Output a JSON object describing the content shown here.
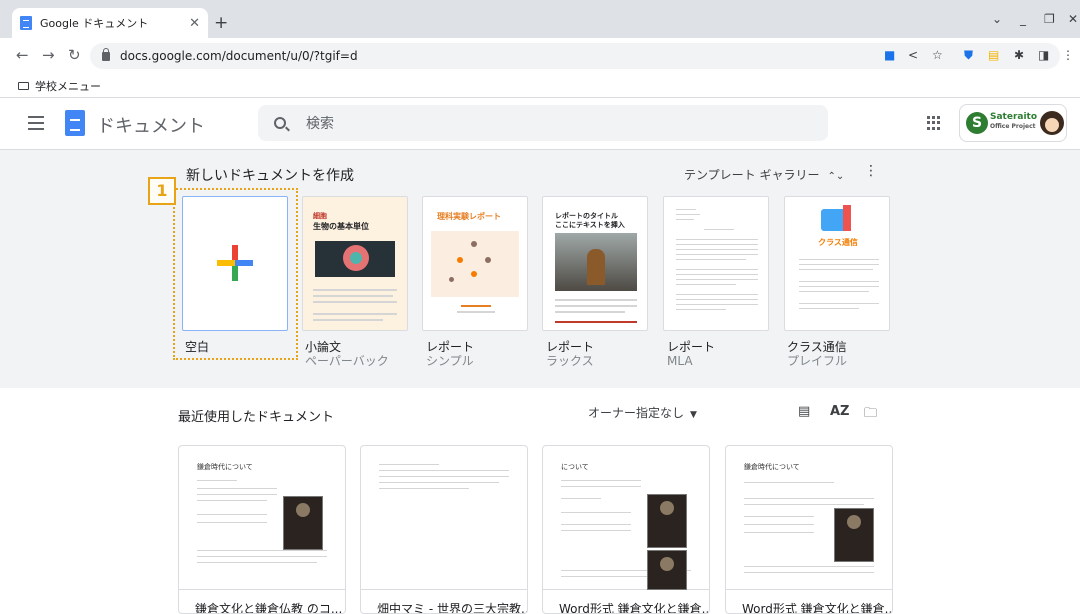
{
  "browser": {
    "tab_title": "Google ドキュメント",
    "url": "docs.google.com/document/u/0/?tgif=d",
    "bookmark": "学校メニュー"
  },
  "header": {
    "app_title": "ドキュメント",
    "search_placeholder": "検索",
    "account_name": "Sateraito",
    "account_sub": "Office Project"
  },
  "templates": {
    "heading": "新しいドキュメントを作成",
    "gallery_label": "テンプレート ギャラリー",
    "badge": "1",
    "items": [
      {
        "title": "空白",
        "subtitle": ""
      },
      {
        "title": "小論文",
        "subtitle": "ペーパーバック"
      },
      {
        "title": "レポート",
        "subtitle": "シンプル"
      },
      {
        "title": "レポート",
        "subtitle": "ラックス"
      },
      {
        "title": "レポート",
        "subtitle": "MLA"
      },
      {
        "title": "クラス通信",
        "subtitle": "プレイフル"
      }
    ],
    "thumb_text": {
      "essay_tag": "細胞",
      "essay_title": "生物の基本単位",
      "science_title": "理科実験レポート",
      "luxe_title": "レポートのタイトル",
      "luxe_sub": "ここにテキストを挿入",
      "class_title": "クラス通信"
    }
  },
  "recent": {
    "heading": "最近使用したドキュメント",
    "owner_filter": "オーナー指定なし",
    "docs": [
      {
        "title": "鎌倉文化と鎌倉仏教 のコ...",
        "preview": "鎌倉時代について"
      },
      {
        "title": "畑中マミ - 世界の三大宗教...",
        "preview": ""
      },
      {
        "title": "Word形式 鎌倉文化と鎌倉...",
        "preview": "について"
      },
      {
        "title": "Word形式 鎌倉文化と鎌倉...",
        "preview": "鎌倉時代について"
      }
    ]
  }
}
